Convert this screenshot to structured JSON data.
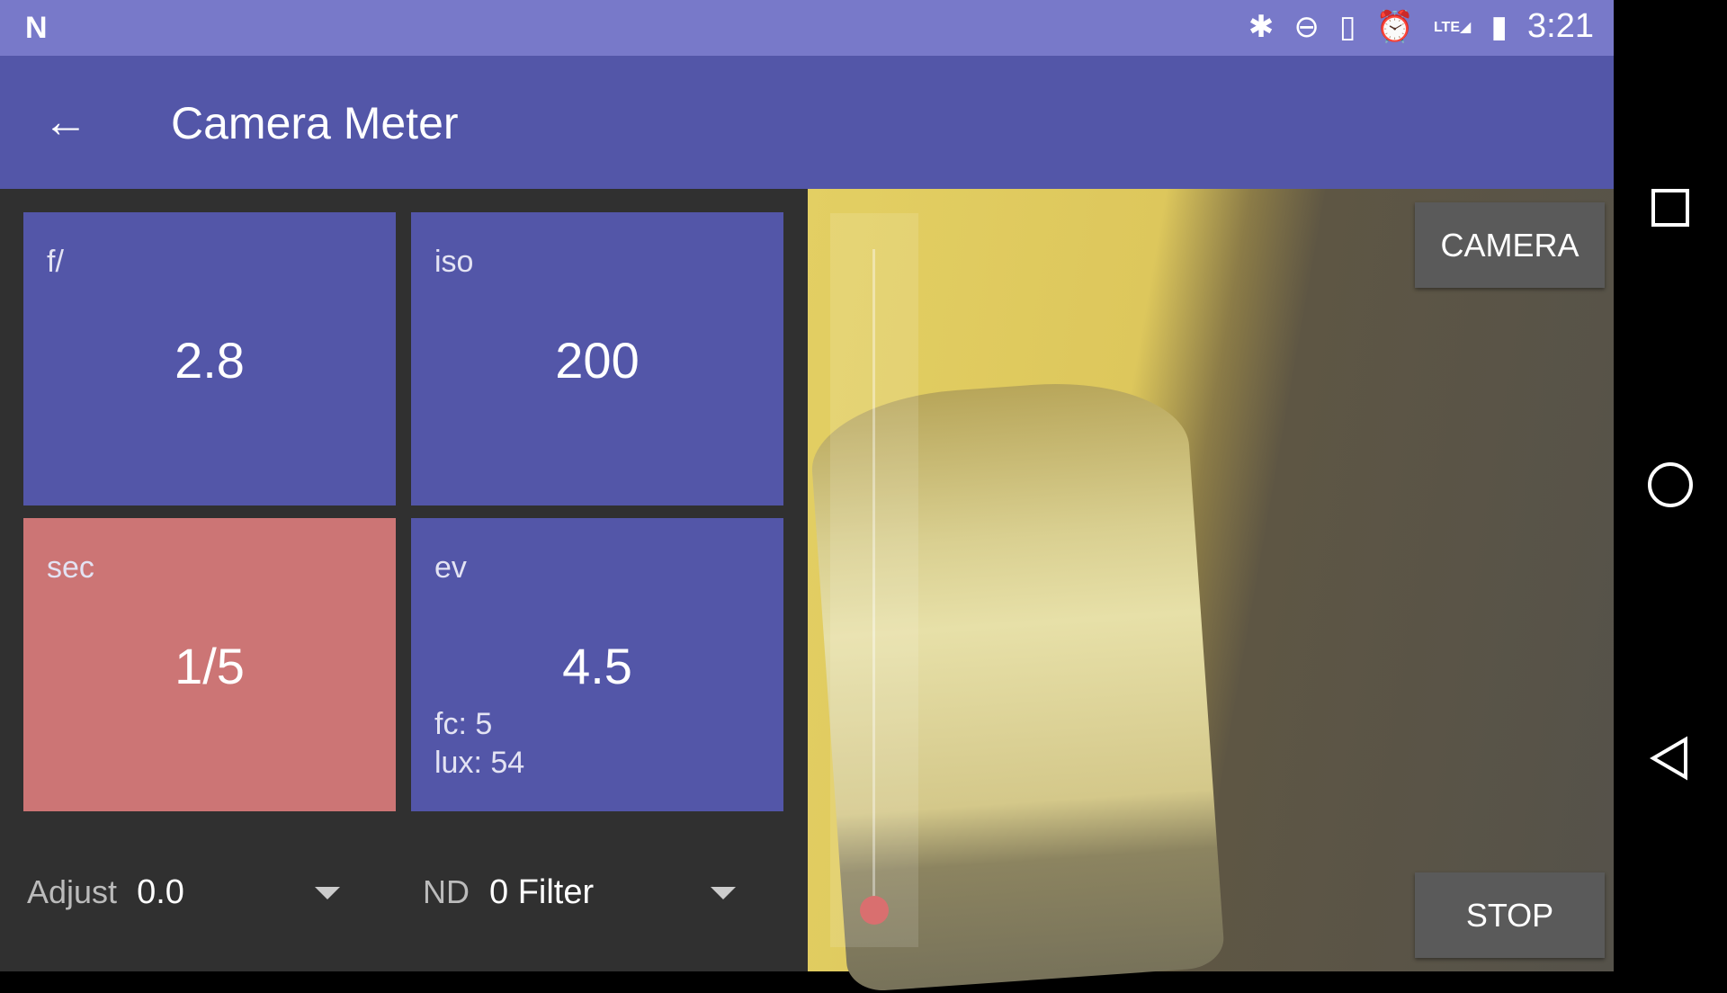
{
  "status_bar": {
    "time": "3:21",
    "icons": [
      "notification-n-icon",
      "bluetooth-icon",
      "do-not-disturb-icon",
      "vibrate-icon",
      "alarm-icon",
      "lte-signal-icon",
      "battery-charging-icon"
    ],
    "lte": "LTE"
  },
  "app_bar": {
    "title": "Camera Meter",
    "back_icon": "arrow-back-icon"
  },
  "tiles": [
    {
      "label": "f/",
      "value": "2.8"
    },
    {
      "label": "iso",
      "value": "200"
    },
    {
      "label": "sec",
      "value": "1/5",
      "color": "#cc7575"
    },
    {
      "label": "ev",
      "value": "4.5",
      "fc": "fc: 5",
      "lux": "lux: 54"
    }
  ],
  "adjust": {
    "label": "Adjust",
    "value": "0.0"
  },
  "nd": {
    "label": "ND",
    "value": "0 Filter"
  },
  "preview": {
    "camera_label": "CAMERA",
    "stop_label": "STOP",
    "exposure_slider_fraction": 0.0
  },
  "colors": {
    "primary": "#5356a8",
    "status": "#7879c9",
    "accent": "#cc7575"
  }
}
